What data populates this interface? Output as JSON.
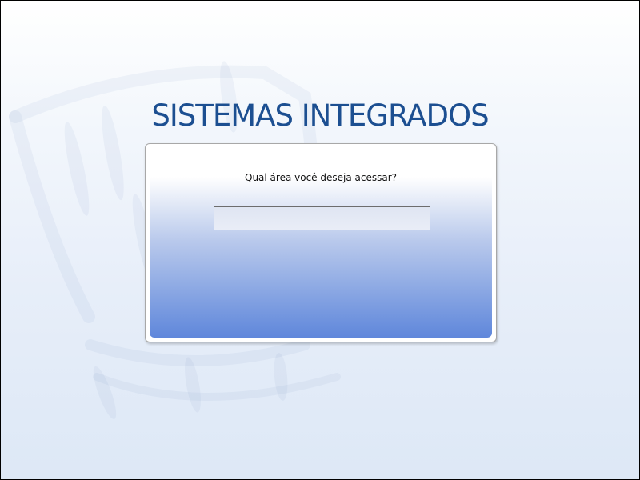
{
  "header": {
    "title": "SISTEMAS INTEGRADOS"
  },
  "login_panel": {
    "question": "Qual área você deseja acessar?",
    "area_input": {
      "value": "",
      "placeholder": ""
    }
  },
  "colors": {
    "title": "#1c4f91",
    "panel_gradient_bottom": "#5f87db",
    "page_background": "#e7eef9"
  }
}
